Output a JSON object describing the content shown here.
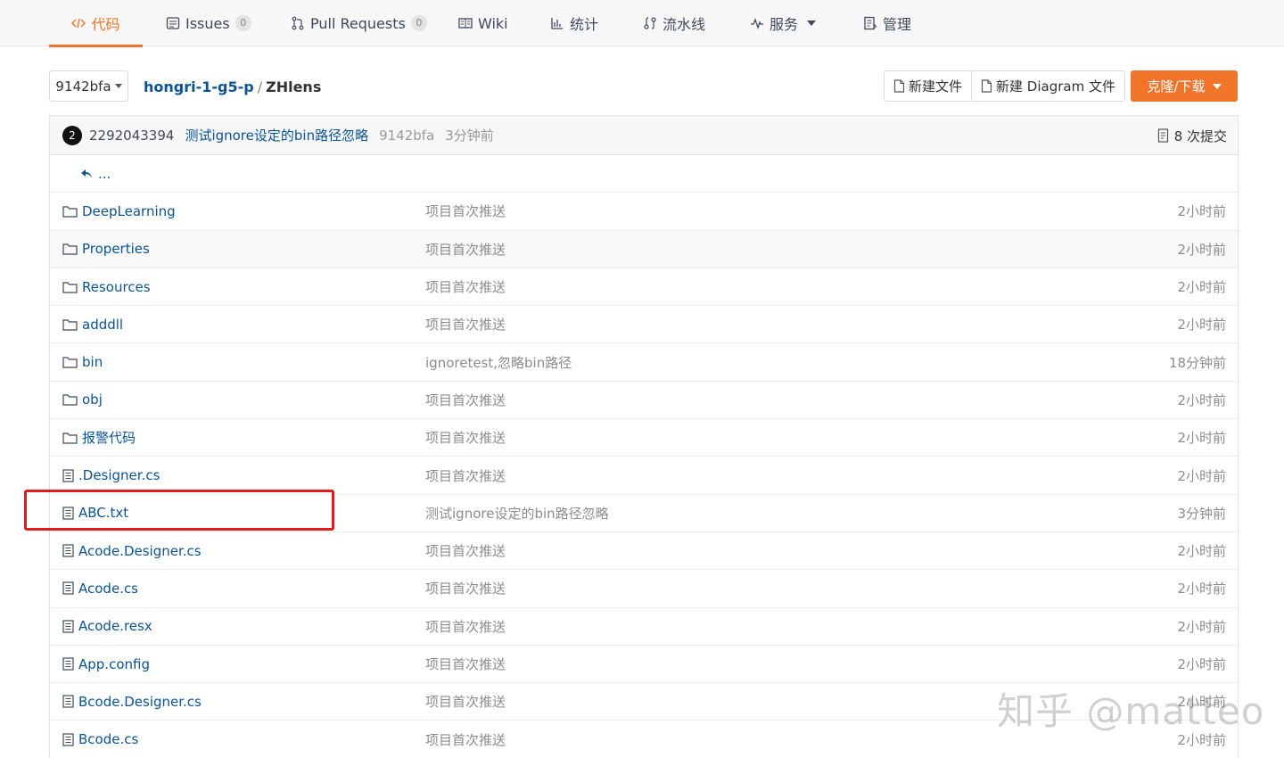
{
  "nav": {
    "tabs": [
      {
        "label": "代码",
        "icon": "code-icon",
        "active": true
      },
      {
        "label": "Issues",
        "icon": "issues-icon",
        "badge": "0"
      },
      {
        "label": "Pull Requests",
        "icon": "pull-request-icon",
        "badge": "0"
      },
      {
        "label": "Wiki",
        "icon": "wiki-icon"
      },
      {
        "label": "统计",
        "icon": "stats-icon"
      },
      {
        "label": "流水线",
        "icon": "pipeline-icon"
      },
      {
        "label": "服务",
        "icon": "service-icon",
        "dropdown": true
      },
      {
        "label": "管理",
        "icon": "manage-icon"
      }
    ]
  },
  "repo": {
    "branch": "9142bfa",
    "owner": "hongri-1-g5-p",
    "separator": "/",
    "name": "ZHlens",
    "new_file_label": "新建文件",
    "new_diagram_label": "新建 Diagram 文件",
    "clone_label": "克隆/下载"
  },
  "commit": {
    "avatar_text": "2",
    "user": "2292043394",
    "message": "测试ignore设定的bin路径忽略",
    "sha": "9142bfa",
    "time": "3分钟前",
    "count_label": "8 次提交"
  },
  "back_label": "...",
  "files": [
    {
      "type": "folder",
      "name": "DeepLearning",
      "message": "项目首次推送",
      "time": "2小时前"
    },
    {
      "type": "folder",
      "name": "Properties",
      "message": "项目首次推送",
      "time": "2小时前"
    },
    {
      "type": "folder",
      "name": "Resources",
      "message": "项目首次推送",
      "time": "2小时前"
    },
    {
      "type": "folder",
      "name": "adddll",
      "message": "项目首次推送",
      "time": "2小时前"
    },
    {
      "type": "folder",
      "name": "bin",
      "message": "ignoretest,忽略bin路径",
      "time": "18分钟前"
    },
    {
      "type": "folder",
      "name": "obj",
      "message": "项目首次推送",
      "time": "2小时前"
    },
    {
      "type": "folder",
      "name": "报警代码",
      "message": "项目首次推送",
      "time": "2小时前"
    },
    {
      "type": "file",
      "name": ".Designer.cs",
      "message": "项目首次推送",
      "time": "2小时前"
    },
    {
      "type": "file",
      "name": "ABC.txt",
      "message": "测试ignore设定的bin路径忽略",
      "time": "3分钟前"
    },
    {
      "type": "file",
      "name": "Acode.Designer.cs",
      "message": "项目首次推送",
      "time": "2小时前"
    },
    {
      "type": "file",
      "name": "Acode.cs",
      "message": "项目首次推送",
      "time": "2小时前"
    },
    {
      "type": "file",
      "name": "Acode.resx",
      "message": "项目首次推送",
      "time": "2小时前"
    },
    {
      "type": "file",
      "name": "App.config",
      "message": "项目首次推送",
      "time": "2小时前"
    },
    {
      "type": "file",
      "name": "Bcode.Designer.cs",
      "message": "项目首次推送",
      "time": "2小时前"
    },
    {
      "type": "file",
      "name": "Bcode.cs",
      "message": "项目首次推送",
      "time": "2小时前"
    }
  ],
  "watermark": "知乎 @matteo",
  "colors": {
    "accent": "#f0742a",
    "link": "#0b5394",
    "highlight": "#e11a1a"
  }
}
